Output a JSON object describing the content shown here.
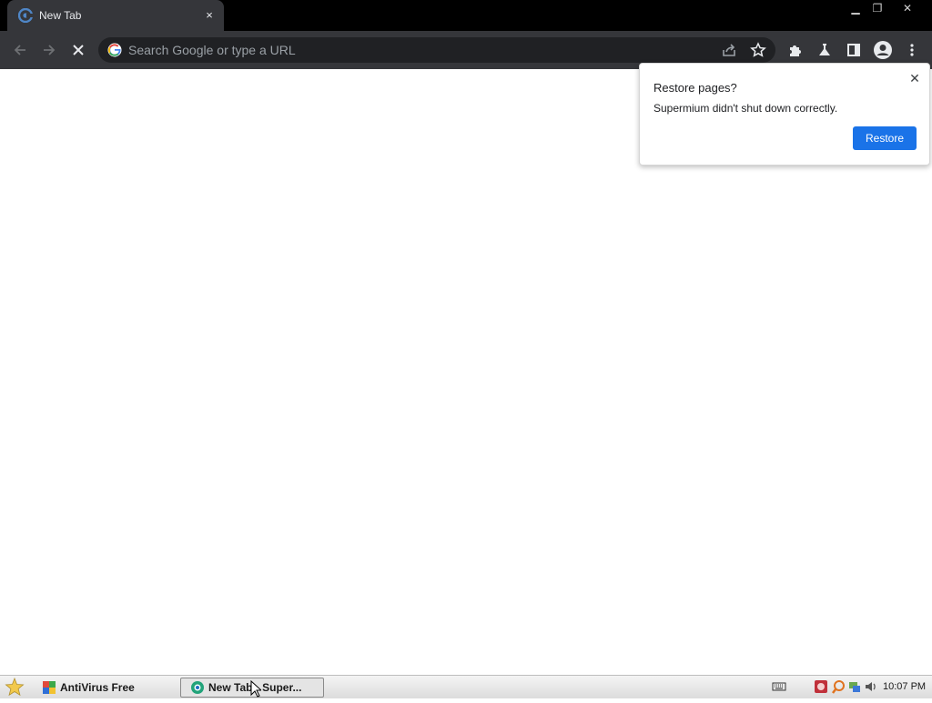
{
  "browser": {
    "tab": {
      "title": "New Tab",
      "favicon": "supermium-icon",
      "close": "×"
    },
    "window_controls": {
      "minimize": "▁",
      "restore": "❐",
      "close": "✕"
    },
    "omnibox": {
      "placeholder": "Search Google or type a URL",
      "value": ""
    }
  },
  "restore_bubble": {
    "title": "Restore pages?",
    "message": "Supermium didn't shut down correctly.",
    "restore_label": "Restore",
    "close": "✕"
  },
  "taskbar": {
    "tasks": [
      {
        "label": "AntiVirus Free",
        "icon": "antivirus-icon",
        "active": false
      },
      {
        "label": "New Tab - Super...",
        "icon": "supermium-icon",
        "active": true
      }
    ],
    "clock": "10:07 PM"
  },
  "colors": {
    "titlebar": "#000000",
    "toolbar": "#35363a",
    "omnibox": "#202124",
    "accent": "#1a73e8"
  }
}
